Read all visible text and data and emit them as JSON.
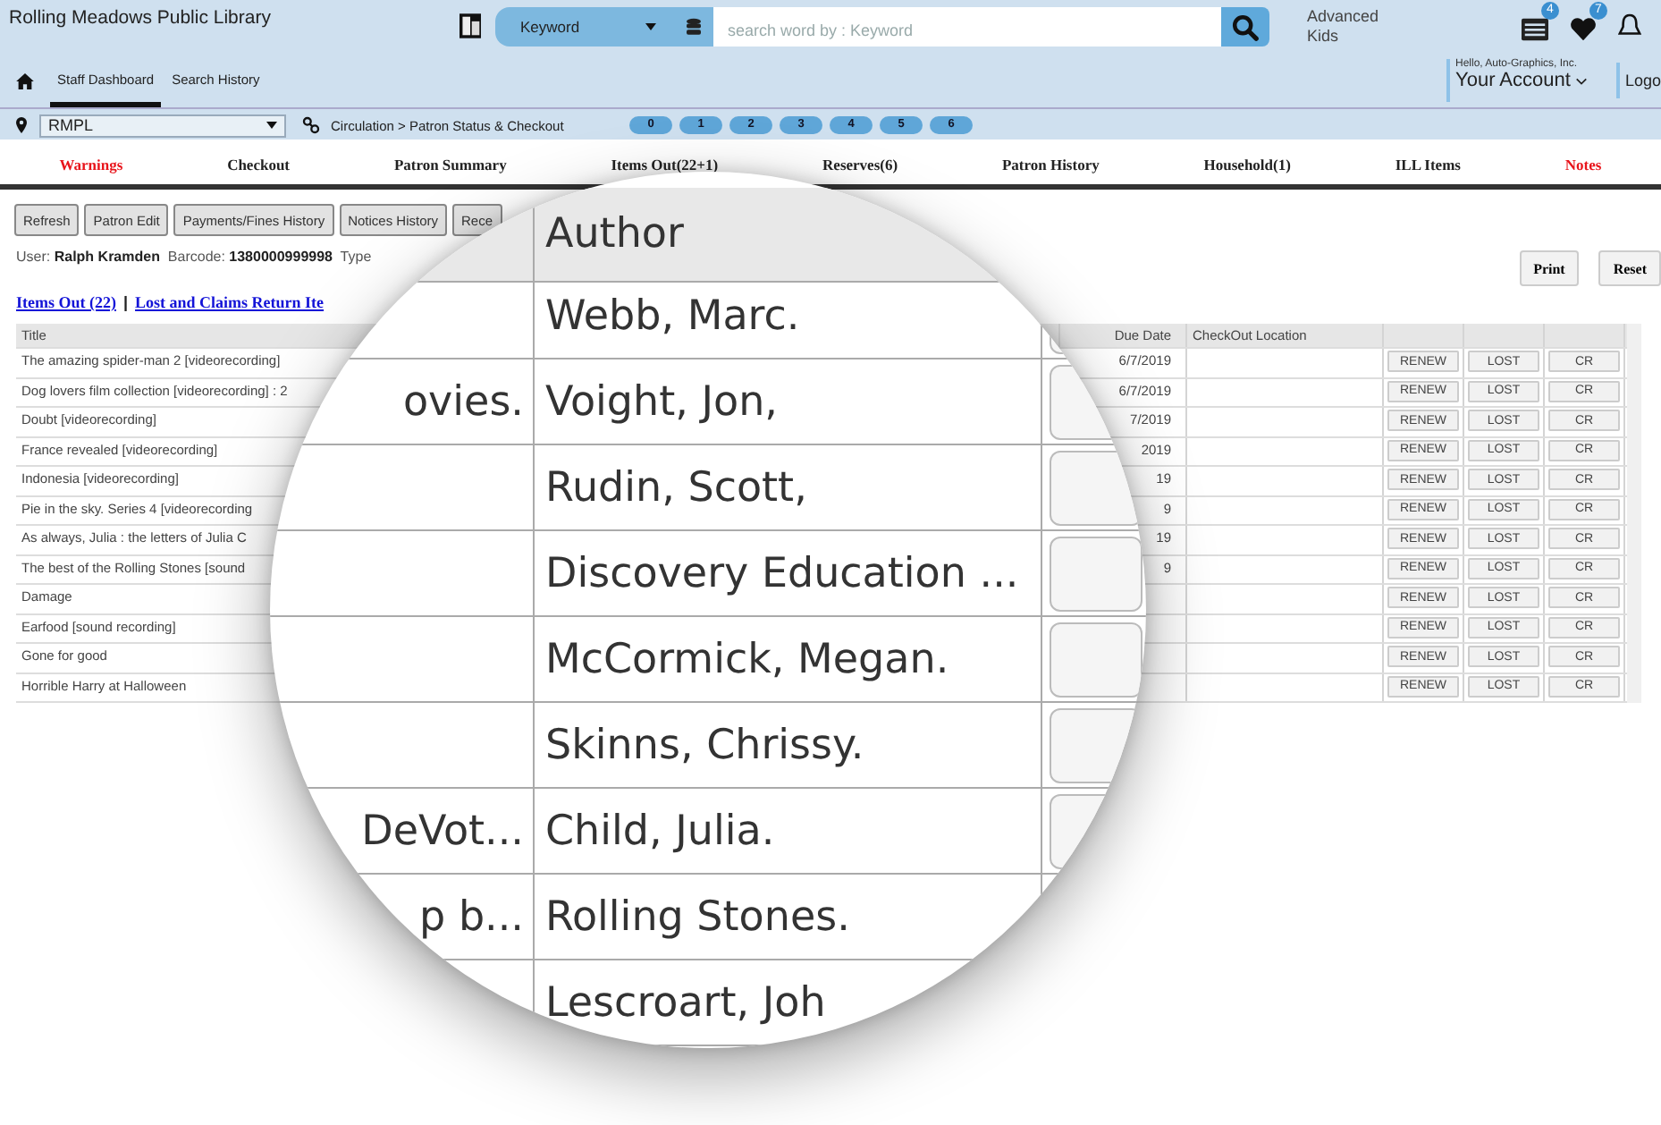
{
  "header": {
    "library_name": "Rolling Meadows Public Library",
    "search_type": "Keyword",
    "search_placeholder": "search word by : Keyword",
    "links": [
      "Advanced",
      "Kids"
    ],
    "notifications": [
      {
        "kind": "list",
        "count": "4"
      },
      {
        "kind": "heart",
        "count": "7"
      },
      {
        "kind": "bell"
      }
    ]
  },
  "nav": {
    "items": [
      {
        "label": "Staff Dashboard",
        "selected": true
      },
      {
        "label": "Search History",
        "selected": false
      }
    ],
    "greeting": "Hello, Auto-Graphics, Inc.",
    "account": "Your Account",
    "logout": "Logo"
  },
  "location": {
    "value": "RMPL",
    "breadcrumb": "Circulation > Patron Status & Checkout",
    "pills": [
      "0",
      "1",
      "2",
      "3",
      "4",
      "5",
      "6"
    ]
  },
  "tabs": [
    {
      "label": "Warnings",
      "alert": true
    },
    {
      "label": "Checkout",
      "alert": false
    },
    {
      "label": "Patron Summary",
      "alert": false
    },
    {
      "label": "Items Out(22+1)",
      "alert": false
    },
    {
      "label": "Reserves(6)",
      "alert": false
    },
    {
      "label": "Patron History",
      "alert": false
    },
    {
      "label": "Household(1)",
      "alert": false
    },
    {
      "label": "ILL Items",
      "alert": false
    },
    {
      "label": "Notes",
      "alert": true
    }
  ],
  "toolbar": {
    "buttons": [
      "Refresh",
      "Patron Edit",
      "Payments/Fines History",
      "Notices History",
      "Rece"
    ],
    "right_buttons": [
      "Print",
      "Reset"
    ]
  },
  "patron_line": "User: **Ralph Kramden**  Barcode: **1380000999998**  Type",
  "list_links": {
    "items": [
      "Items Out (22)",
      "Lost and Claims Return Ite"
    ],
    "separator": "|"
  },
  "table": {
    "columns": [
      "Title",
      "Due Date",
      "CheckOut Location"
    ],
    "rows": [
      {
        "title": "The amazing spider-man 2 [videorecording]",
        "due_date": "6/7/2019",
        "actions": [
          "RENEW",
          "LOST",
          "CR"
        ]
      },
      {
        "title": "Dog lovers film collection [videorecording] : 2",
        "due_date": "6/7/2019",
        "actions": [
          "RENEW",
          "LOST",
          "CR"
        ]
      },
      {
        "title": "Doubt [videorecording]",
        "due_date": "7/2019",
        "actions": [
          "RENEW",
          "LOST",
          "CR"
        ]
      },
      {
        "title": "France revealed [videorecording]",
        "due_date": "2019",
        "actions": [
          "RENEW",
          "LOST",
          "CR"
        ]
      },
      {
        "title": "Indonesia [videorecording]",
        "due_date": "19",
        "actions": [
          "RENEW",
          "LOST",
          "CR"
        ]
      },
      {
        "title": "Pie in the sky. Series 4 [videorecording",
        "due_date": "9",
        "actions": [
          "RENEW",
          "LOST",
          "CR"
        ]
      },
      {
        "title": "As always, Julia : the letters of Julia C",
        "due_date": "19",
        "actions": [
          "RENEW",
          "LOST",
          "CR"
        ]
      },
      {
        "title": "The best of the Rolling Stones [sound",
        "due_date": "9",
        "actions": [
          "RENEW",
          "LOST",
          "CR"
        ]
      },
      {
        "title": "Damage",
        "actions": [
          "RENEW",
          "LOST",
          "CR"
        ]
      },
      {
        "title": "Earfood [sound recording]",
        "actions": [
          "RENEW",
          "LOST",
          "CR"
        ]
      },
      {
        "title": "Gone for good",
        "actions": [
          "RENEW",
          "LOST",
          "CR"
        ]
      },
      {
        "title": "Horrible Harry at Halloween",
        "actions": [
          "RENEW",
          "LOST",
          "CR"
        ]
      }
    ]
  },
  "magnifier": {
    "column": "Author",
    "rows": [
      {
        "author": "Webb, Marc.",
        "checked": false
      },
      {
        "left": "ovies.",
        "author": "Voight, Jon,",
        "checked": false
      },
      {
        "author": "Rudin, Scott,",
        "checked": false
      },
      {
        "author": "Discovery Education ...",
        "checked": false
      },
      {
        "author": "McCormick, Megan.",
        "checked": false
      },
      {
        "author": "Skinns, Chrissy.",
        "checked": false
      },
      {
        "left": "DeVot...",
        "author": "Child, Julia.",
        "checked": false
      },
      {
        "left": "p b...",
        "author": "Rolling Stones."
      },
      {
        "author": "Lescroart, Joh"
      }
    ]
  }
}
